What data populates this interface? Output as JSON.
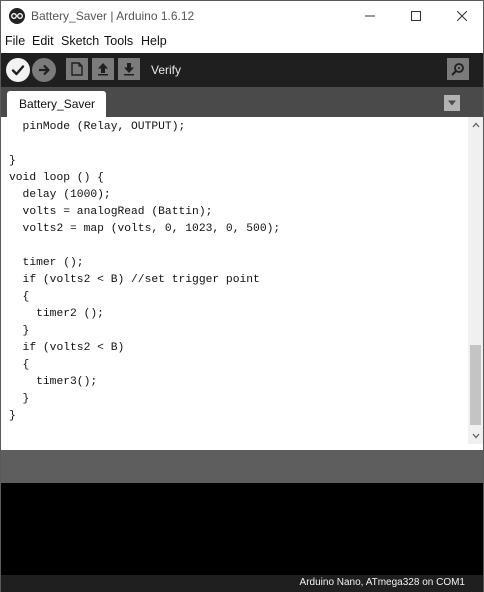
{
  "window": {
    "title": "Battery_Saver | Arduino 1.6.12"
  },
  "menu": [
    "File",
    "Edit",
    "Sketch",
    "Tools",
    "Help"
  ],
  "toolbar": {
    "active_label": "Verify",
    "icons": [
      "verify-icon",
      "upload-icon",
      "new-icon",
      "open-icon",
      "save-icon",
      "serial-monitor-icon"
    ]
  },
  "tabs": [
    {
      "label": "Battery_Saver",
      "active": true
    }
  ],
  "editor": {
    "lines": [
      "  pinMode (Relay, OUTPUT);",
      "",
      "}",
      "void loop () {",
      "  delay (1000);",
      "  volts = analogRead (Battin);",
      "  volts2 = map (volts, 0, 1023, 0, 500);",
      "",
      "  timer ();",
      "  if (volts2 < B) //set trigger point",
      "  {",
      "    timer2 ();",
      "  }",
      "  if (volts2 < B)",
      "  {",
      "    timer3();",
      "  }",
      "}"
    ]
  },
  "status": {
    "board": "Arduino Nano, ATmega328 on COM1"
  },
  "colors": {
    "toolbar_bg": "#1f1f1f",
    "tabbar_bg": "#4a4a4a",
    "message_bg": "#5e5e5e",
    "console_bg": "#000000"
  }
}
